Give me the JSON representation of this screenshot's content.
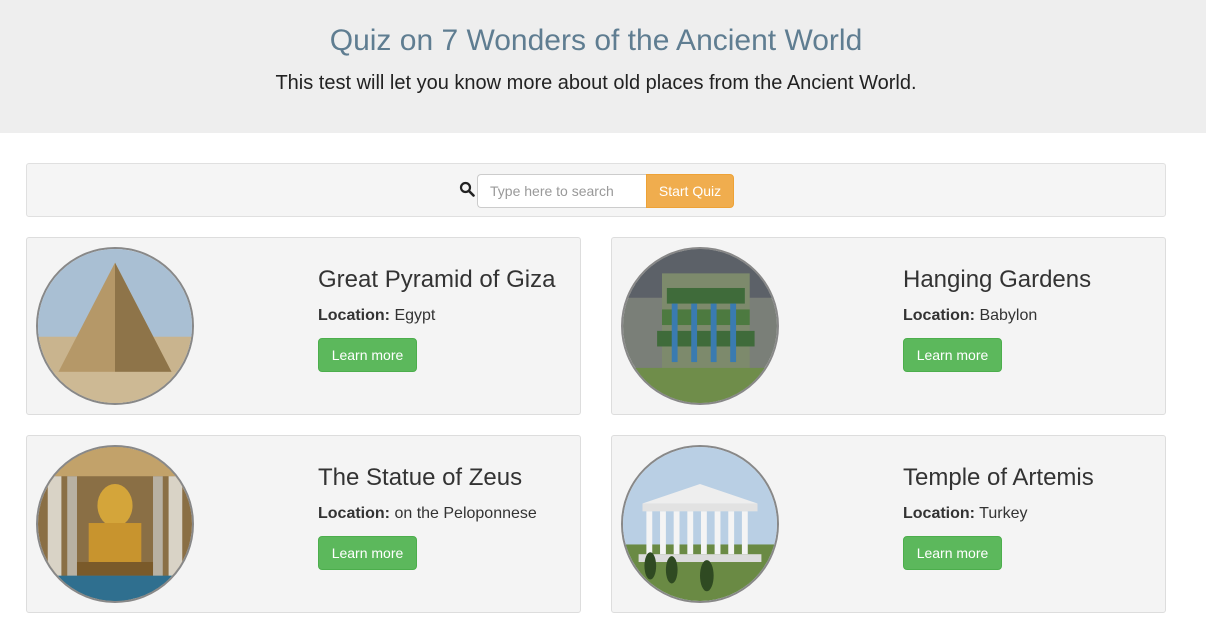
{
  "header": {
    "title": "Quiz on 7 Wonders of the Ancient World",
    "subtitle": "This test will let you know more about old places from the Ancient World."
  },
  "search": {
    "icon": "search-icon",
    "placeholder": "Type here to search",
    "value": "",
    "button_label": "Start Quiz"
  },
  "colors": {
    "title": "#5f7d91",
    "jumbotron_bg": "#eeeeee",
    "start_button": "#f0ad4e",
    "learn_button": "#5cb85c"
  },
  "cards": [
    {
      "name": "Great Pyramid of Giza",
      "location_label": "Location:",
      "location": "Egypt",
      "button_label": "Learn more"
    },
    {
      "name": "Hanging Gardens",
      "location_label": "Location:",
      "location": "Babylon",
      "button_label": "Learn more"
    },
    {
      "name": "The Statue of Zeus",
      "location_label": "Location:",
      "location": "on the Peloponnese",
      "button_label": "Learn more"
    },
    {
      "name": "Temple of Artemis",
      "location_label": "Location:",
      "location": "Turkey",
      "button_label": "Learn more"
    }
  ]
}
